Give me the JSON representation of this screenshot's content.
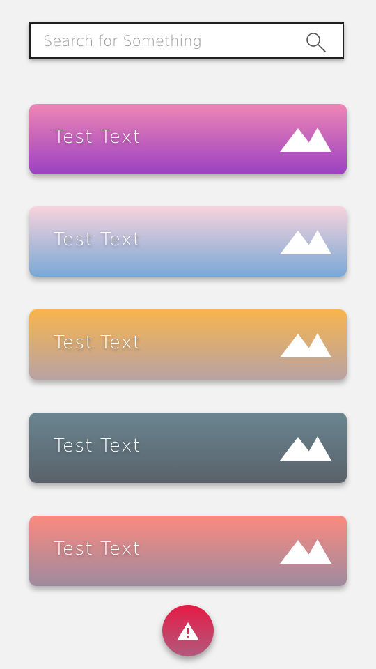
{
  "search": {
    "placeholder": "Search for Something",
    "value": "",
    "icon": "search-icon"
  },
  "cards": [
    {
      "label": "Test Text",
      "icon": "mountain-icon",
      "gradient": [
        "#ee87b5",
        "#9b41c2"
      ]
    },
    {
      "label": "Test Text",
      "icon": "mountain-icon",
      "gradient": [
        "#f7d3dc",
        "#7aa8d6"
      ]
    },
    {
      "label": "Test Text",
      "icon": "mountain-icon",
      "gradient": [
        "#f8b54d",
        "#b8a2a4"
      ]
    },
    {
      "label": "Test Text",
      "icon": "mountain-icon",
      "gradient": [
        "#6a8590",
        "#59626b"
      ]
    },
    {
      "label": "Test Text",
      "icon": "mountain-icon",
      "gradient": [
        "#fb8a7f",
        "#9e8a9f"
      ]
    }
  ],
  "fab": {
    "icon": "warning-icon",
    "gradient": [
      "#e51a45",
      "#b15a7d"
    ]
  },
  "colors": {
    "background": "#f2f2f2",
    "search_border": "#1f1f1f",
    "card_text": "#ffffff"
  }
}
